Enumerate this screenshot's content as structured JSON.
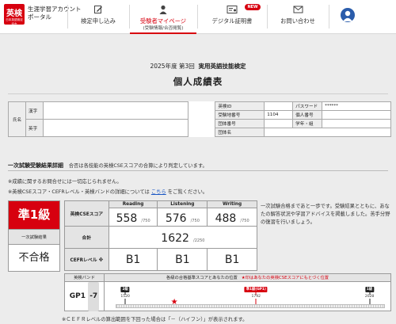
{
  "header": {
    "logo_text": "英検",
    "logo_sub": "日本英語検定協会",
    "portal_line1": "生涯学習アカウント",
    "portal_line2": "ポータル",
    "nav": [
      {
        "label": "検定申し込み",
        "sub": ""
      },
      {
        "label": "受験者マイページ",
        "sub": "(受験情報/合否閲覧)"
      },
      {
        "label": "デジタル証明書",
        "sub": ""
      },
      {
        "label": "お問い合わせ",
        "sub": ""
      }
    ],
    "new_badge": "NEW",
    "accent_color": "#d7000f"
  },
  "exam": {
    "year_round": "2025年度 第3回",
    "exam_name": "実用英語技能検定",
    "page_title": "個人成績表"
  },
  "info_table": {
    "name_label": "氏名",
    "kanji_label": "漢字",
    "eiji_label": "英字",
    "kanji_value": "",
    "eiji_value": "",
    "eiken_id_label": "英検ID",
    "eiken_id_value": "",
    "password_label": "パスワード",
    "password_value": "******",
    "exam_number_label": "受験地番号",
    "exam_number_value": "1104",
    "personal_number_label": "個人番号",
    "personal_number_value": "",
    "group_number_label": "団体番号",
    "group_number_value": "",
    "grade_year_label": "学年・組",
    "grade_year_value": "",
    "group_name_label": "団体名",
    "group_name_value": ""
  },
  "section": {
    "title": "一次試験受験結果詳細",
    "subtitle": "合否は各技能の英検CSEスコアの合算により判定しています。",
    "note1": "※成績に関するお問合せには一切応じられません。",
    "note2_before": "※英検CSEスコア・CEFRレベル・英検バンドの詳細については",
    "note2_link": "こちら",
    "note2_after": "をご覧ください。"
  },
  "result": {
    "grade": "準1級",
    "result_label": "一次試験結果",
    "result_value": "不合格"
  },
  "scores": {
    "cse_label": "英検CSEスコア",
    "total_label": "合計",
    "cefr_label": "CEFRレベル",
    "cefr_mark": "※",
    "skills": [
      {
        "name": "Reading",
        "score": "558",
        "max": "/750",
        "cefr": "B1"
      },
      {
        "name": "Listening",
        "score": "576",
        "max": "/750",
        "cefr": "B1"
      },
      {
        "name": "Writing",
        "score": "488",
        "max": "/750",
        "cefr": "B1"
      }
    ],
    "total": "1622",
    "total_max": "/2250"
  },
  "advice": "一次試験合格まであと一歩です。受験結果とともに、あなたの解答状況や学習アドバイスを掲載しました。苦手分野の復習を行いましょう。",
  "band": {
    "label": "英検バンド",
    "header_text": "各級の合格基準スコアとあなたの位置",
    "header_note": "★印はあなたの英検CSEスコアにもとづく位置",
    "value_prefix": "GP1",
    "value_diff": "-7",
    "scale_min": 1500,
    "scale_max": 2060,
    "your_score": 1622,
    "markers": [
      {
        "label": "2級",
        "score": 1520,
        "color": "#222222"
      },
      {
        "label": "準1級(GP1)",
        "score": 1792,
        "color": "#d7000f"
      },
      {
        "label": "1級",
        "score": 2028,
        "color": "#222222"
      }
    ]
  },
  "footer_note": "※ＣＥＦＲレベルの算出範囲を下回った場合は「－（ハイフン）」が表示されます。"
}
